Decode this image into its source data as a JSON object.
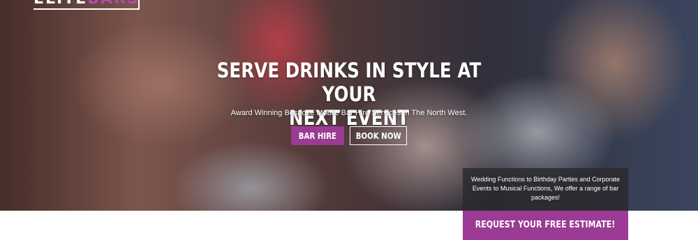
{
  "logo": {
    "text_a": "ELITE",
    "text_b": "BARS"
  },
  "hero": {
    "headline_line1": "SERVE DRINKS IN STYLE AT YOUR",
    "headline_line2": "NEXT EVENT",
    "subheadline": "Award Winning Bespoke Mobile Bar Hire Services In The North West.",
    "buttons": {
      "bar_hire": "BAR HIRE",
      "book_now": "BOOK NOW"
    }
  },
  "info_panel": {
    "text": "Wedding Functions to Birthday Parties and Corporate Events to Musical Functions, We offer a range of bar packages!"
  },
  "estimate": {
    "label": "REQUEST YOUR FREE ESTIMATE!"
  },
  "colors": {
    "accent": "#9b3b94",
    "panel": "#2a2a2d"
  }
}
